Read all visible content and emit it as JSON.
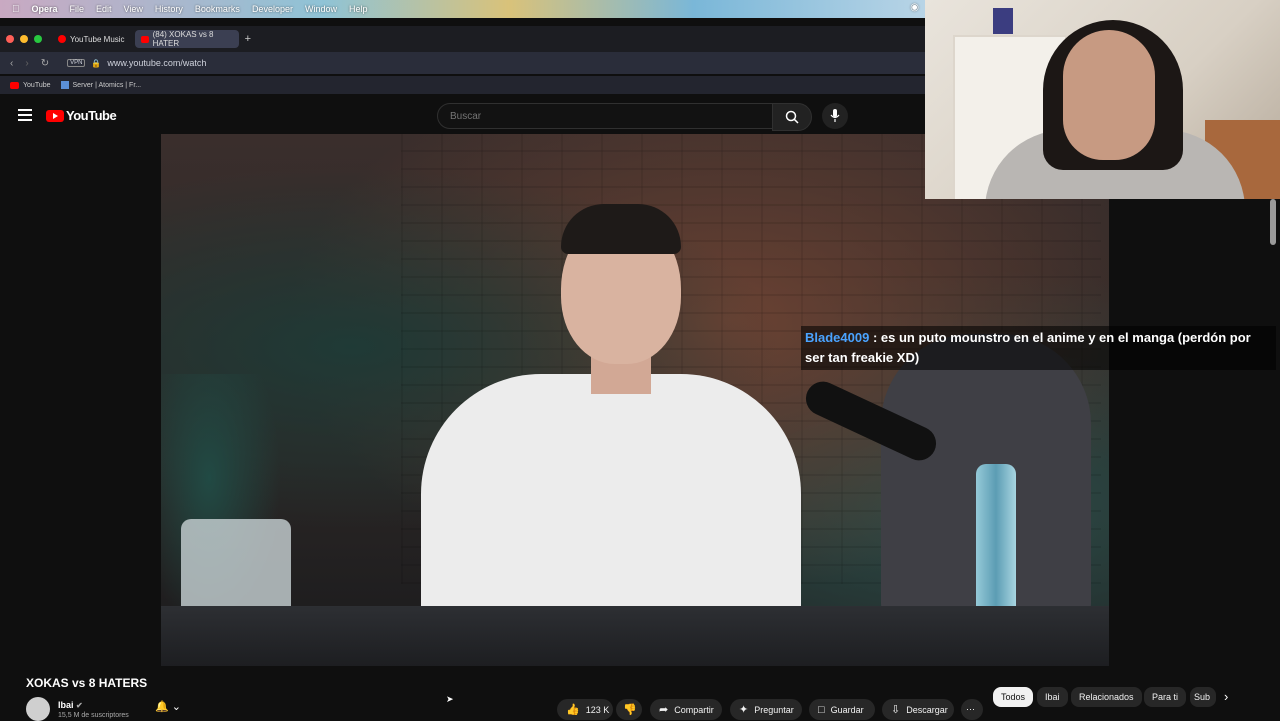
{
  "menubar": {
    "app": "Opera",
    "items": [
      "File",
      "Edit",
      "View",
      "History",
      "Bookmarks",
      "Developer",
      "Window",
      "Help"
    ]
  },
  "tabs": [
    {
      "label": "YouTube Music"
    },
    {
      "label": "(84) XOKAS vs 8 HATER"
    }
  ],
  "address": {
    "url": "www.youtube.com/watch",
    "vpn": "VPN"
  },
  "bookmarks": [
    {
      "label": "YouTube"
    },
    {
      "label": "Server | Atomics | Fr..."
    }
  ],
  "youtube": {
    "logo": "YouTube",
    "search_placeholder": "Buscar"
  },
  "chat": {
    "user": "Blade4009",
    "message": ": es un puto mounstro en el anime y en el manga (perdón por ser tan freakie XD)"
  },
  "video": {
    "title": "XOKAS vs 8 HATERS",
    "channel": "Ibai",
    "subscribers": "15,5 M de suscriptores"
  },
  "actions": {
    "likes": "123 K",
    "share": "Compartir",
    "ask": "Preguntar",
    "save": "Guardar",
    "download": "Descargar"
  },
  "chips": [
    "Todos",
    "Ibai",
    "Relacionados",
    "Para ti",
    "Sub"
  ]
}
